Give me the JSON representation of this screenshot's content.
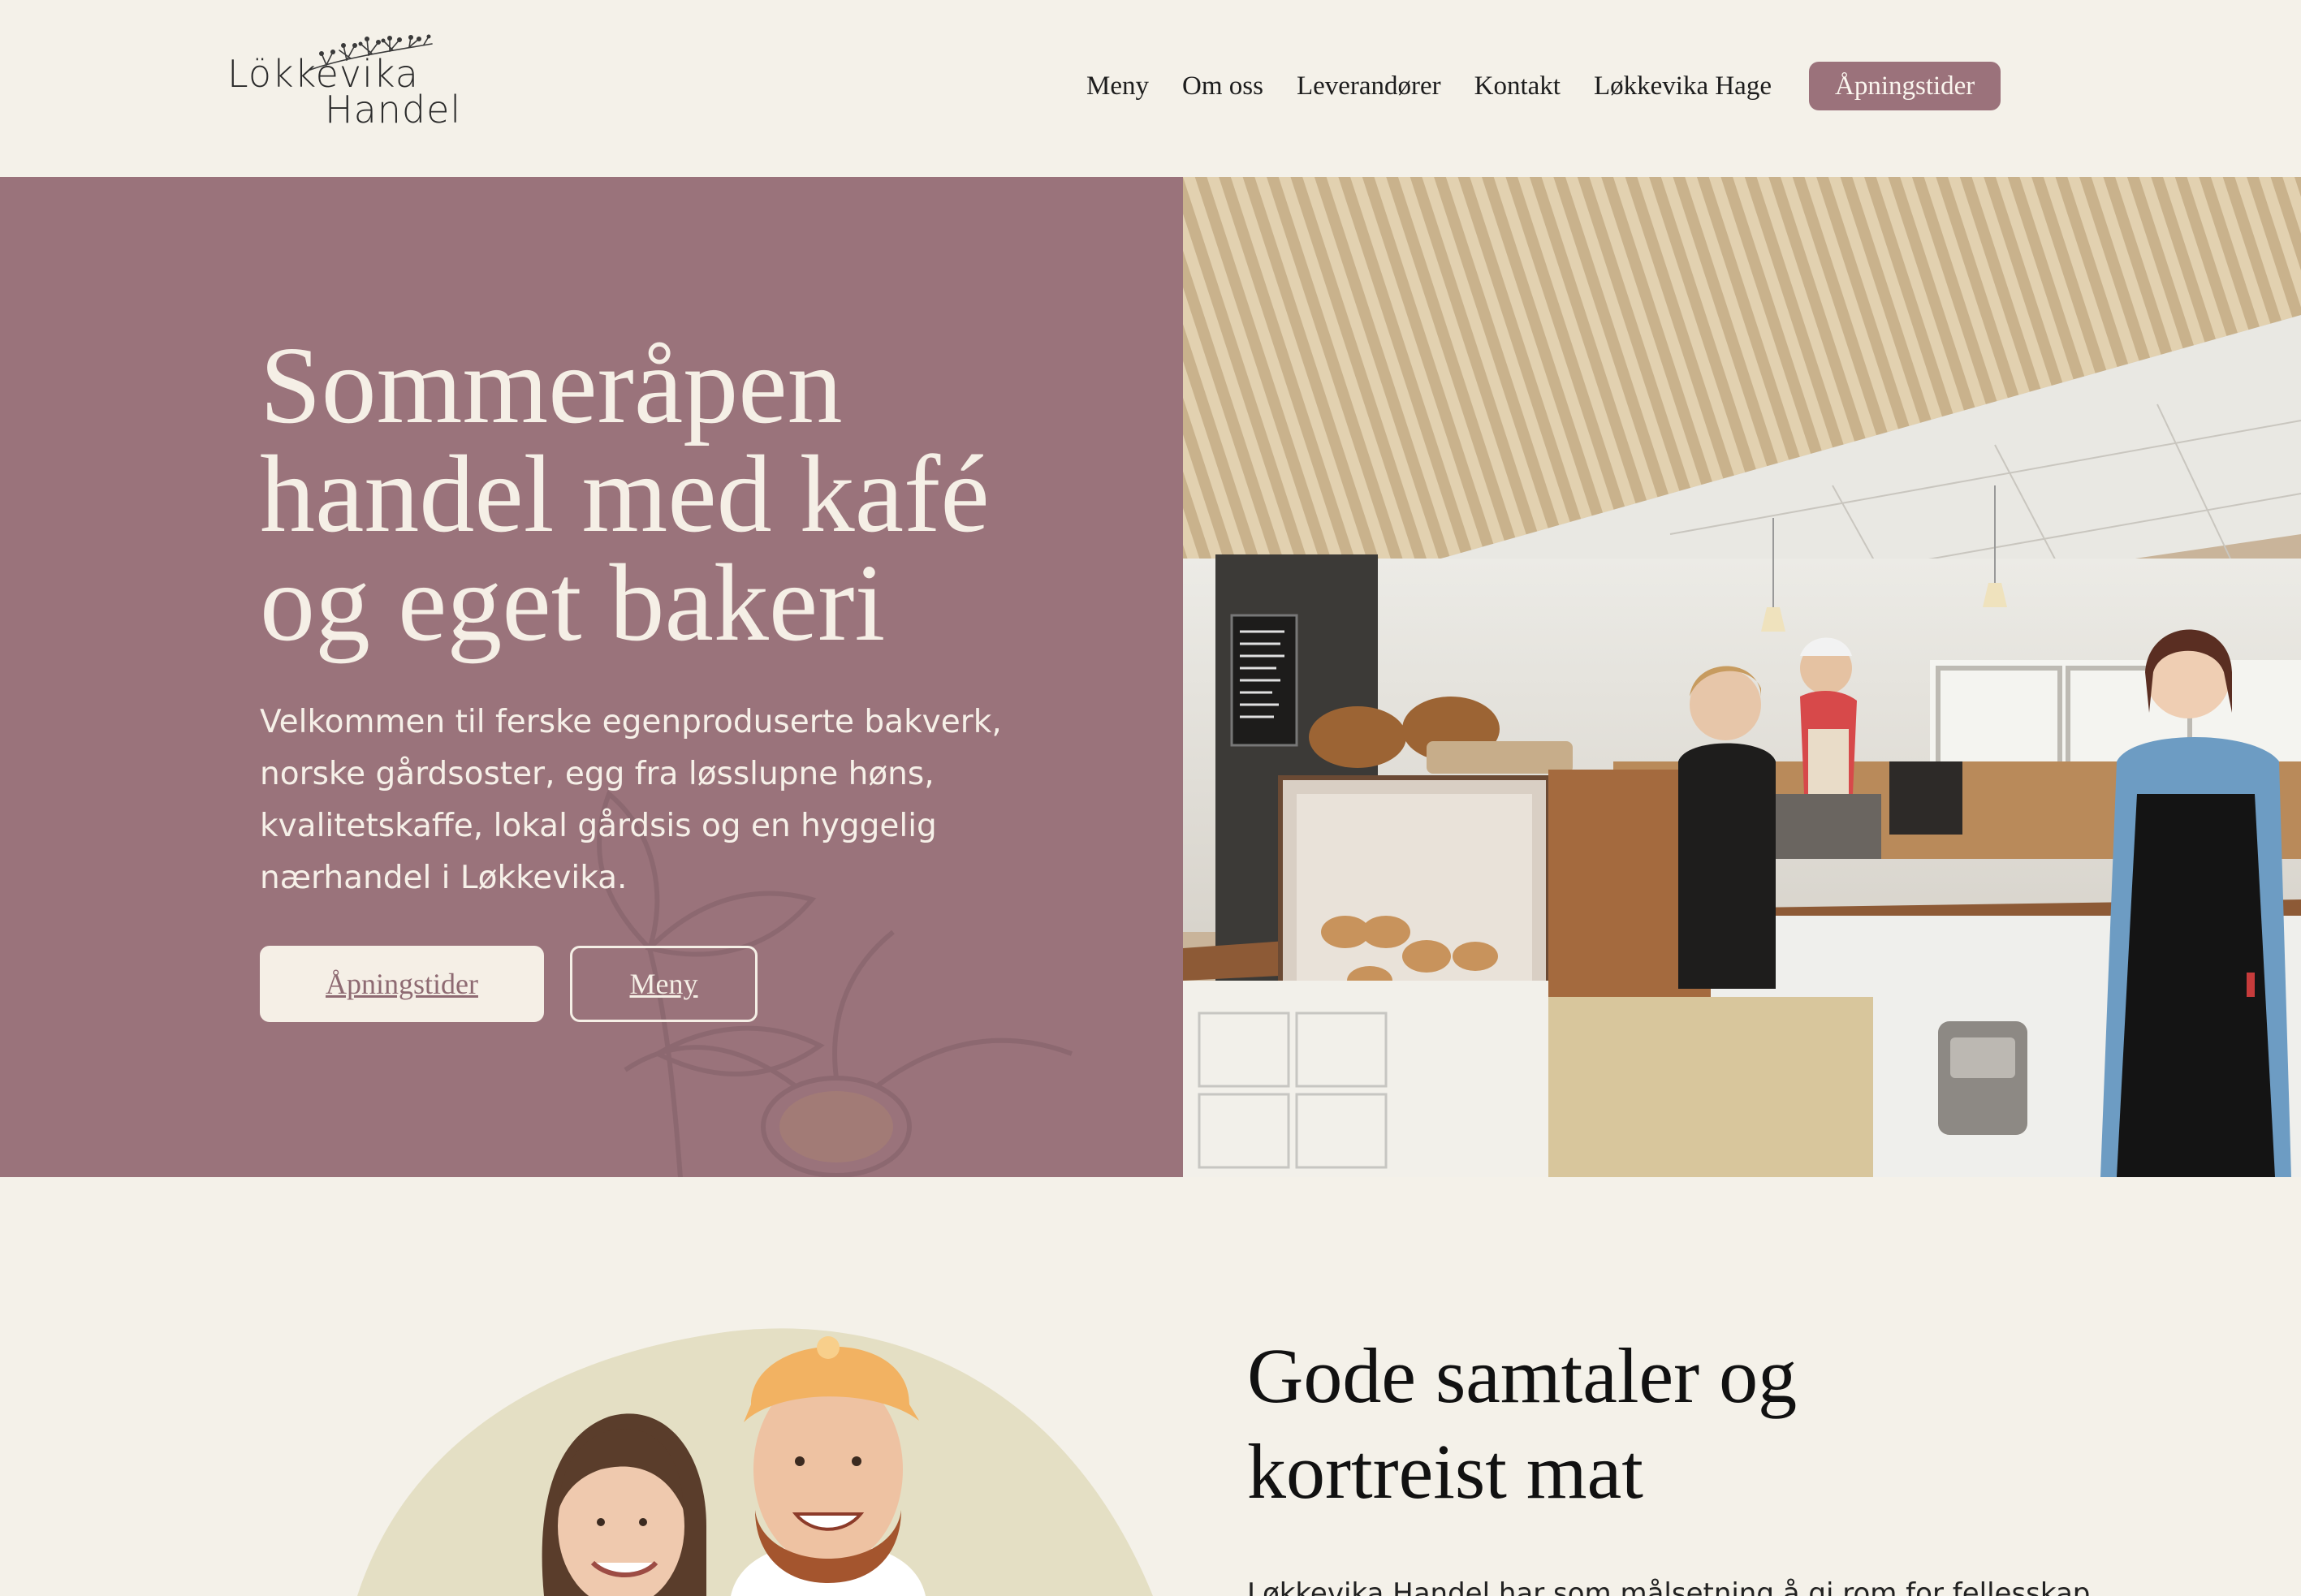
{
  "brand": {
    "logo_line1": "Lökkevika",
    "logo_line2": "Handel",
    "accent_color": "#9a737b",
    "background_color": "#f4f1e9"
  },
  "nav": {
    "items": [
      {
        "label": "Meny"
      },
      {
        "label": "Om oss"
      },
      {
        "label": "Leverandører"
      },
      {
        "label": "Kontakt"
      },
      {
        "label": "Løkkevika Hage"
      }
    ],
    "cta_label": "Åpningstider"
  },
  "hero": {
    "title_lines": [
      "Sommeråpen",
      "handel med kafé",
      "og eget bakeri"
    ],
    "text_lines": [
      "Velkommen til ferske egenproduserte bakverk,",
      "norske gårdsoster, egg fra løsslupne høns,",
      "kvalitetskaffe, lokal gårdsis og en hyggelig",
      "nærhandel i Løkkevika."
    ],
    "primary_button": "Åpningstider",
    "secondary_button": "Meny",
    "image": "cafe-interior-photo"
  },
  "about": {
    "title_lines": [
      "Gode samtaler og",
      "kortreist mat"
    ],
    "text_line": "Løkkevika Handel har som målsetning å gi rom for fellesskap",
    "image": "owners-portrait-photo"
  }
}
